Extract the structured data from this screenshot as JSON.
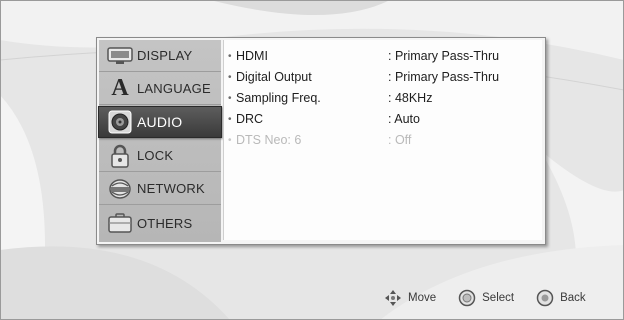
{
  "sidebar": {
    "items": [
      {
        "label": "DISPLAY",
        "icon": "display-icon"
      },
      {
        "label": "LANGUAGE",
        "icon": "language-icon"
      },
      {
        "label": "AUDIO",
        "icon": "audio-icon",
        "selected": true
      },
      {
        "label": "LOCK",
        "icon": "lock-icon"
      },
      {
        "label": "NETWORK",
        "icon": "network-icon"
      },
      {
        "label": "OTHERS",
        "icon": "others-icon"
      }
    ]
  },
  "settings": [
    {
      "name": "HDMI",
      "value": ": Primary Pass-Thru",
      "enabled": true
    },
    {
      "name": "Digital Output",
      "value": ": Primary Pass-Thru",
      "enabled": true
    },
    {
      "name": "Sampling Freq.",
      "value": ": 48KHz",
      "enabled": true
    },
    {
      "name": "DRC",
      "value": ": Auto",
      "enabled": true
    },
    {
      "name": "DTS Neo: 6",
      "value": ": Off",
      "enabled": false
    }
  ],
  "bullet": "•",
  "language_icon_glyph": "A",
  "hints": {
    "move": "Move",
    "select": "Select",
    "back": "Back"
  },
  "colors": {
    "selected_bg": "#4a4a4a",
    "sidebar_bg": "#bdbdbd",
    "content_bg": "#fdfdfd",
    "disabled_text": "#b9b9b9"
  }
}
